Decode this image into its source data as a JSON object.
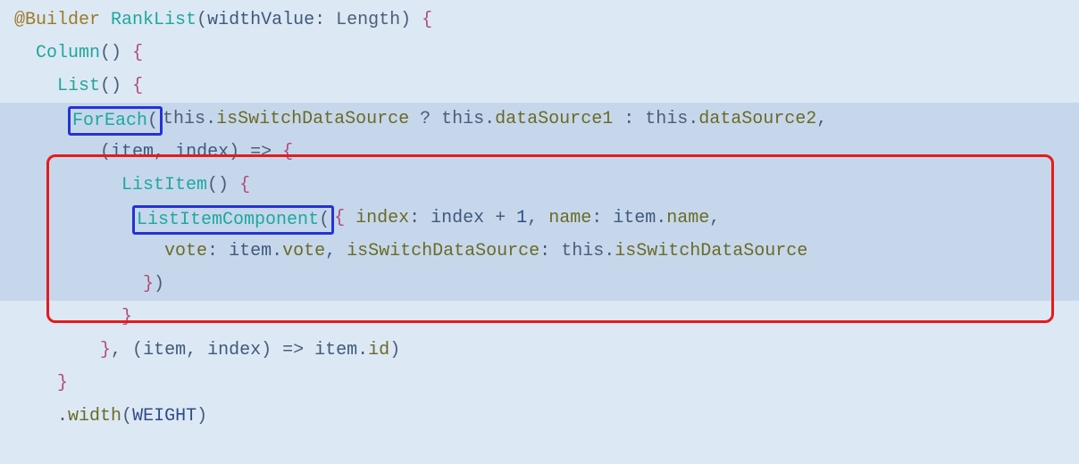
{
  "code": {
    "line1": {
      "ann": "@Builder",
      "func": "RankList",
      "open": "(",
      "param": "widthValue",
      "colon": ":",
      "type": "Length",
      "close": ")",
      "brace": "{"
    },
    "line2": {
      "indent": "  ",
      "func": "Column",
      "parens": "()",
      "brace": "{"
    },
    "line3": {
      "indent": "    ",
      "func": "List",
      "parens": "()",
      "brace": "{"
    },
    "line4": {
      "indent": "     ",
      "foreach": "ForEach",
      "paren": "(",
      "this1": "this",
      "dot1": ".",
      "prop1": "isSwitchDataSource",
      "q": " ? ",
      "this2": "this",
      "dot2": ".",
      "prop2": "dataSource1",
      "colon": " : ",
      "this3": "this",
      "dot3": ".",
      "prop3": "dataSource2",
      "comma": ","
    },
    "line5": {
      "indent": "        ",
      "open": "(",
      "p1": "item",
      "c": ", ",
      "p2": "index",
      "close": ")",
      "arrow": " => ",
      "brace": "{"
    },
    "line6": {
      "indent": "          ",
      "func": "ListItem",
      "parens": "()",
      "brace": "{"
    },
    "line7": {
      "indent": "           ",
      "comp": "ListItemComponent",
      "open": "(",
      "obrace": "{",
      "k1": " index",
      "colon1": ": ",
      "v1a": "index",
      "plus": " + ",
      "one": "1",
      "c1": ", ",
      "k2": "name",
      "colon2": ": ",
      "v2a": "item",
      "dot2": ".",
      "v2b": "name",
      "c2": ","
    },
    "line8": {
      "indent": "              ",
      "k3": "vote",
      "colon3": ": ",
      "v3a": "item",
      "dot3": ".",
      "v3b": "vote",
      "c3": ", ",
      "k4": "isSwitchDataSource",
      "colon4": ": ",
      "this": "this",
      "dot4": ".",
      "v4": "isSwitchDataSource"
    },
    "line9": {
      "indent": "            ",
      "cbrace": "}",
      "cparen": ")"
    },
    "line10": {
      "indent": "          ",
      "brace": "}"
    },
    "line11": {
      "indent": "        ",
      "cbrace": "}",
      "c": ", ",
      "open": "(",
      "p1": "item",
      "cc": ", ",
      "p2": "index",
      "close": ")",
      "arrow": " => ",
      "v1": "item",
      "dot": ".",
      "v2": "id",
      "cparen": ")"
    },
    "line12": {
      "indent": "    ",
      "brace": "}"
    },
    "line13": {
      "indent": "    ",
      "dot": ".",
      "func": "width",
      "open": "(",
      "arg": "WEIGHT",
      "close": ")"
    }
  }
}
